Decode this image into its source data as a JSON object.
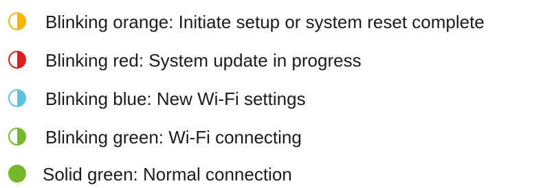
{
  "legend": {
    "items": [
      {
        "label": "Blinking orange: Initiate setup or system reset complete",
        "indicator": "half-filled-circle-icon",
        "state": "blinking",
        "color": "#f7b500"
      },
      {
        "label": "Blinking red: System update in progress",
        "indicator": "half-filled-circle-icon",
        "state": "blinking",
        "color": "#e01e1e"
      },
      {
        "label": "Blinking blue: New Wi-Fi settings",
        "indicator": "half-filled-circle-icon",
        "state": "blinking",
        "color": "#5bc3dc"
      },
      {
        "label": "Blinking green: Wi-Fi connecting",
        "indicator": "half-filled-circle-icon",
        "state": "blinking",
        "color": "#76b82a"
      },
      {
        "label": "Solid green: Normal connection",
        "indicator": "filled-circle-icon",
        "state": "solid",
        "color": "#76b82a"
      }
    ]
  }
}
